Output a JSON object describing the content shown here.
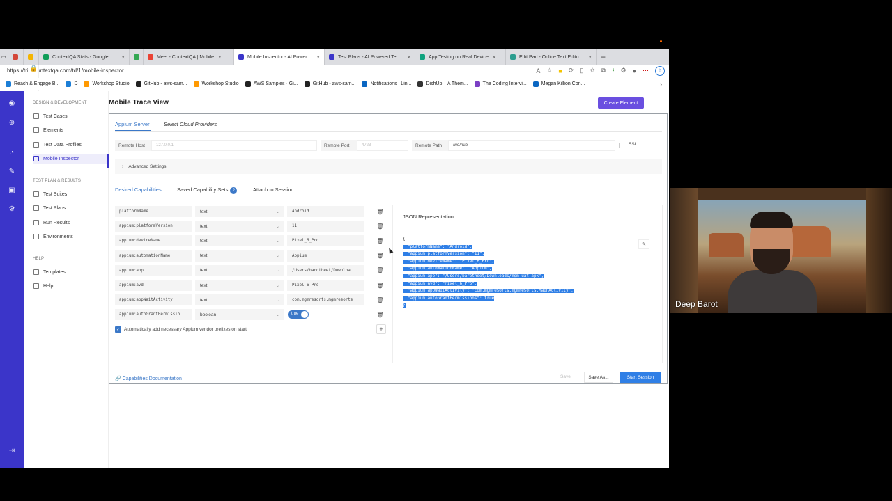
{
  "browser": {
    "tabs": [
      {
        "title": "",
        "color": "#d44638"
      },
      {
        "title": "",
        "color": "#f4b400"
      },
      {
        "title": "ContextQA Stats - Google She",
        "color": "#0f9d58"
      },
      {
        "title": "",
        "color": "#34a853"
      },
      {
        "title": "Meet - ContextQA | Mobile",
        "color": "#ea4335"
      },
      {
        "title": "Mobile Inspector - AI Powered",
        "color": "#3b35c9"
      },
      {
        "title": "Test Plans - AI Powered Test Au",
        "color": "#3b35c9"
      },
      {
        "title": "App Testing on Real Device",
        "color": "#10a37f"
      },
      {
        "title": "Edit Pad - Online Text Editor &",
        "color": "#2b9d8f"
      }
    ],
    "url": "https://trial.contextqa.com/td/1/mobile-inspector",
    "bookmarks": [
      {
        "label": "Reach & Engage B...",
        "color": "#1c7ed6"
      },
      {
        "label": "D",
        "color": "#1c7ed6"
      },
      {
        "label": "Workshop Studio",
        "color": "#ff9900"
      },
      {
        "label": "GitHub - aws-sam...",
        "color": "#222222"
      },
      {
        "label": "Workshop Studio",
        "color": "#ff9900"
      },
      {
        "label": "AWS Samples · Gi...",
        "color": "#222222"
      },
      {
        "label": "GitHub - aws-sam...",
        "color": "#222222"
      },
      {
        "label": "Notifications | Lin...",
        "color": "#0a66c2"
      },
      {
        "label": "DishUp – A Them...",
        "color": "#333333"
      },
      {
        "label": "The Coding Intervi...",
        "color": "#7b3fc4"
      },
      {
        "label": "Megan Killion Con...",
        "color": "#0a66c2"
      }
    ]
  },
  "sidebar": {
    "sections": [
      {
        "title": "DESIGN & DEVELOPMENT",
        "items": [
          "Test Cases",
          "Elements",
          "Test Data Profiles",
          "Mobile Inspector"
        ]
      },
      {
        "title": "TEST PLAN & RESULTS",
        "items": [
          "Test Suites",
          "Test Plans",
          "Run Results",
          "Environments"
        ]
      },
      {
        "title": "HELP",
        "items": [
          "Templates",
          "Help"
        ]
      }
    ],
    "active_item": "Mobile Inspector"
  },
  "page": {
    "title": "Mobile Trace View",
    "create_button": "Create Element"
  },
  "server_tabs": {
    "active": "Appium Server",
    "other": "Select Cloud Providers"
  },
  "connection": {
    "remote_host_label": "Remote Host",
    "remote_host_placeholder": "127.0.0.1",
    "remote_port_label": "Remote Port",
    "remote_port_placeholder": "4723",
    "remote_path_label": "Remote Path",
    "remote_path_value": "/wd/hub",
    "ssl_label": "SSL"
  },
  "advanced_settings": "Advanced Settings",
  "cap_tabs": {
    "desired": "Desired Capabilities",
    "saved": "Saved Capability Sets",
    "saved_count": "2",
    "attach": "Attach to Session..."
  },
  "capabilities": [
    {
      "name": "platformName",
      "type": "text",
      "value": "Android"
    },
    {
      "name": "appium:platformVersion",
      "type": "text",
      "value": "11"
    },
    {
      "name": "appium:deviceName",
      "type": "text",
      "value": "Pixel_6_Pro"
    },
    {
      "name": "appium:automationName",
      "type": "text",
      "value": "Appium"
    },
    {
      "name": "appium:app",
      "type": "text",
      "value": "/Users/barotheet/Downloa"
    },
    {
      "name": "appium:avd",
      "type": "text",
      "value": "Pixel_6_Pro"
    },
    {
      "name": "appium:appWaitActivity",
      "type": "text",
      "value": "com.mgmresorts.mgmresorts"
    },
    {
      "name": "appium:autoGrantPermissio",
      "type": "boolean",
      "value": "true"
    }
  ],
  "auto_prefix_label": "Automatically add necessary Appium vendor prefixes on start",
  "json": {
    "title": "JSON Representation",
    "lines": [
      "{",
      "  \"platformName\": \"Android\",",
      "  \"appium:platformVersion\": \"11\",",
      "  \"appium:deviceName\": \"Pixel_6_Pro\",",
      "  \"appium:automationName\": \"Appium\",",
      "  \"appium:app\": \"/Users/barotheet/Downloads/mgm-uat.apk\",",
      "  \"appium:avd\": \"Pixel_6_Pro\",",
      "  \"appium:appWaitActivity\": \"com.mgmresorts.mgmresorts.MainActivity\",",
      "  \"appium:autoGrantPermissions\": true",
      "}"
    ]
  },
  "footer": {
    "docs_link": "Capabilities Documentation",
    "save": "Save",
    "save_as": "Save As...",
    "start_session": "Start Session"
  },
  "participant": {
    "name": "Deep Barot"
  }
}
